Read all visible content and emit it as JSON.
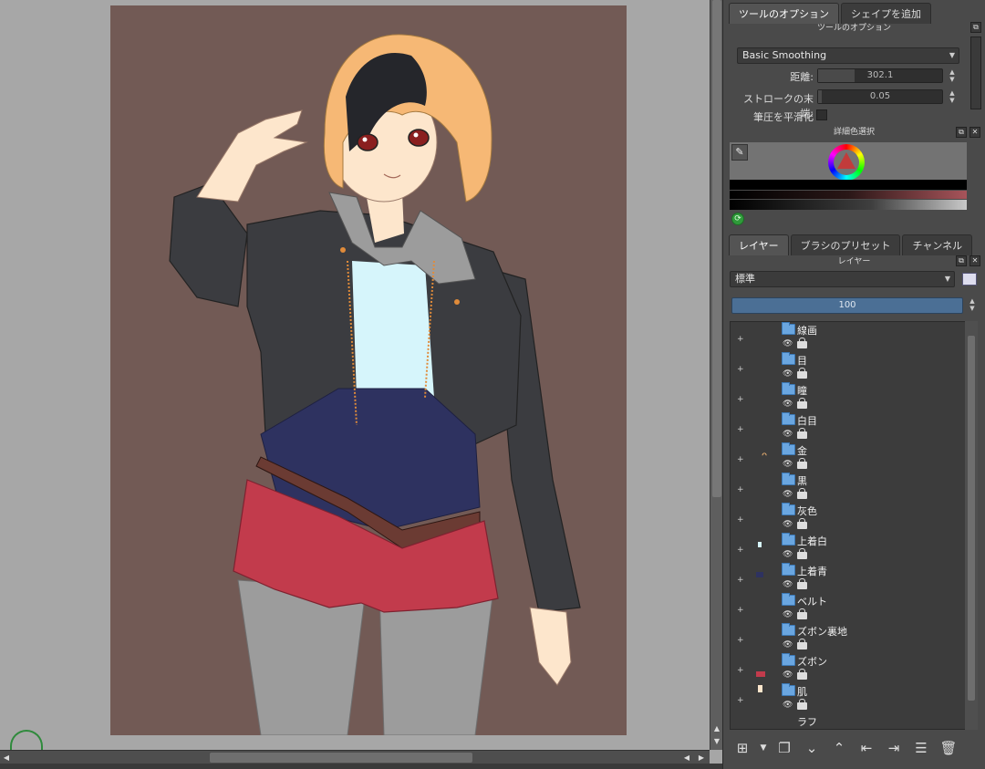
{
  "dock": {
    "top_tabs": [
      "ツールのオプション",
      "シェイプを追加"
    ],
    "tool_options_title": "ツールのオプション",
    "smoothing_mode": "Basic Smoothing",
    "distance_label": "距離:",
    "distance_value": "302.1",
    "stroke_end_label": "ストロークの末端:",
    "stroke_end_value": "0.05",
    "smooth_pressure_label": "筆圧を平滑化",
    "color_selector_title": "詳細色選択",
    "mid_tabs": [
      "レイヤー",
      "ブラシのプリセット",
      "チャンネル"
    ],
    "layers_title": "レイヤー",
    "blend_mode": "標準",
    "opacity": "100",
    "layers": [
      {
        "name": "線画"
      },
      {
        "name": "目"
      },
      {
        "name": "瞳"
      },
      {
        "name": "白目"
      },
      {
        "name": "金"
      },
      {
        "name": "黒"
      },
      {
        "name": "灰色"
      },
      {
        "name": "上着白"
      },
      {
        "name": "上着青"
      },
      {
        "name": "ベルト"
      },
      {
        "name": "ズボン裏地"
      },
      {
        "name": "ズボン"
      },
      {
        "name": "肌"
      },
      {
        "name": "ラフ"
      }
    ]
  },
  "colors": {
    "canvas_bg": "#725a55",
    "dock_bg": "#4a4a4a",
    "folder": "#6aa6e0",
    "hair_orange": "#f6b875",
    "jacket": "#3b3c40",
    "shirt": "#2e3260",
    "shorts": "#c23b4c",
    "tights": "#9c9c9c",
    "skin": "#fde6cc"
  }
}
